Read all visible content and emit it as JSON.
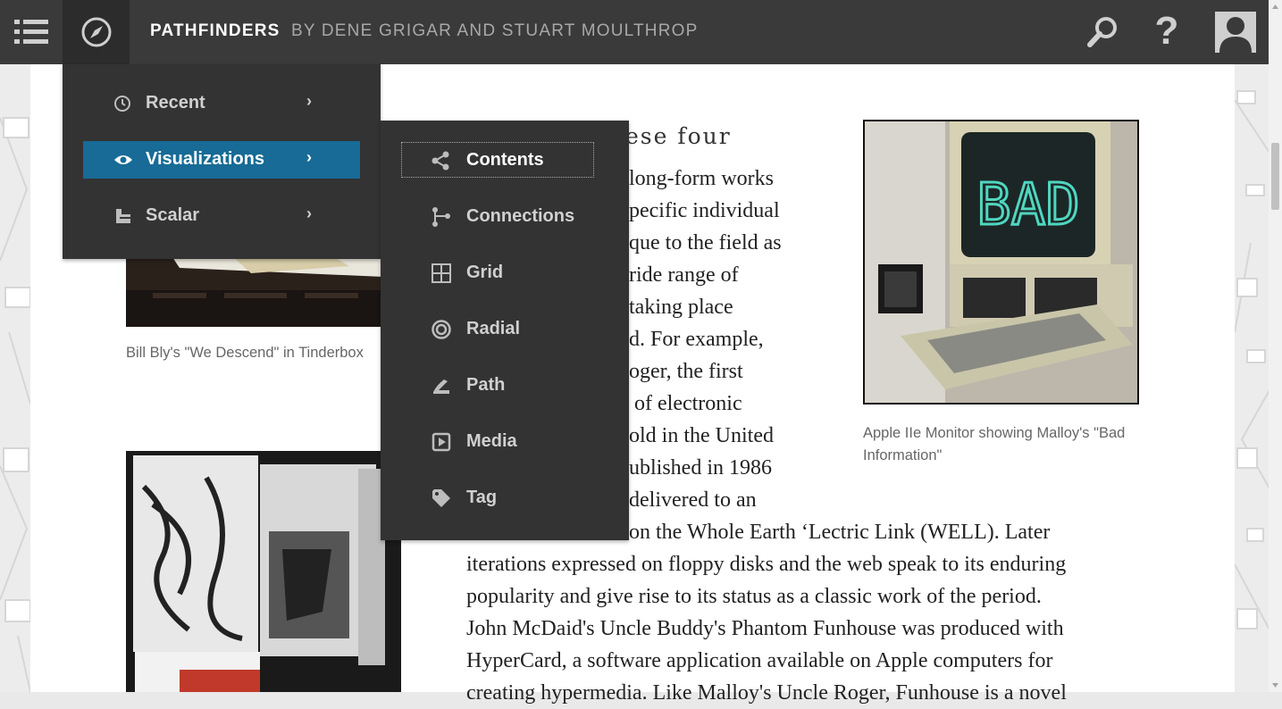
{
  "header": {
    "title": "PATHFINDERS",
    "authors": "BY DENE GRIGAR AND STUART MOULTHROP",
    "menu_icon": "hamburger-icon",
    "nav_icon": "compass-icon",
    "search_icon": "search-icon",
    "help_label": "?",
    "user_icon": "avatar-icon"
  },
  "nav_menu": {
    "items": [
      {
        "label": "Recent",
        "icon": "clock-icon",
        "chevron": "›"
      },
      {
        "label": "Visualizations",
        "icon": "eye-icon",
        "chevron": "›"
      },
      {
        "label": "Scalar",
        "icon": "scalar-icon",
        "chevron": "›"
      }
    ],
    "active_color": "#176b96"
  },
  "viz_submenu": {
    "items": [
      {
        "label": "Contents",
        "icon": "contents-icon"
      },
      {
        "label": "Connections",
        "icon": "connections-icon"
      },
      {
        "label": "Grid",
        "icon": "grid-icon"
      },
      {
        "label": "Radial",
        "icon": "radial-icon"
      },
      {
        "label": "Path",
        "icon": "path-icon"
      },
      {
        "label": "Media",
        "icon": "media-icon"
      },
      {
        "label": "Tag",
        "icon": "tag-icon"
      }
    ]
  },
  "content": {
    "heading_fragment": "ese four",
    "lines": [
      "long-form works",
      "pecific individual",
      "que to the field as",
      "ride range of",
      "taking place",
      "d. For example,",
      "oger, the first",
      "of electronic",
      "old in the United",
      "ublished in 1986",
      "delivered to an",
      "on the Whole Earth ‘Lectric Link (WELL). Later",
      "iterations expressed on floppy disks and the web speak to its enduring",
      "popularity and give rise to its status as a classic work of the period.",
      "John McDaid's Uncle Buddy's Phantom Funhouse was produced with",
      "HyperCard, a software application available on Apple computers for",
      "creating hypermedia. Like Malloy's Uncle Roger, Funhouse is a novel"
    ],
    "captions": {
      "tinderbox": "Bill Bly's \"We Descend\" in Tinderbox",
      "apple": "Apple IIe Monitor showing Malloy's \"Bad Information\""
    },
    "monitor_text": "BAD"
  }
}
